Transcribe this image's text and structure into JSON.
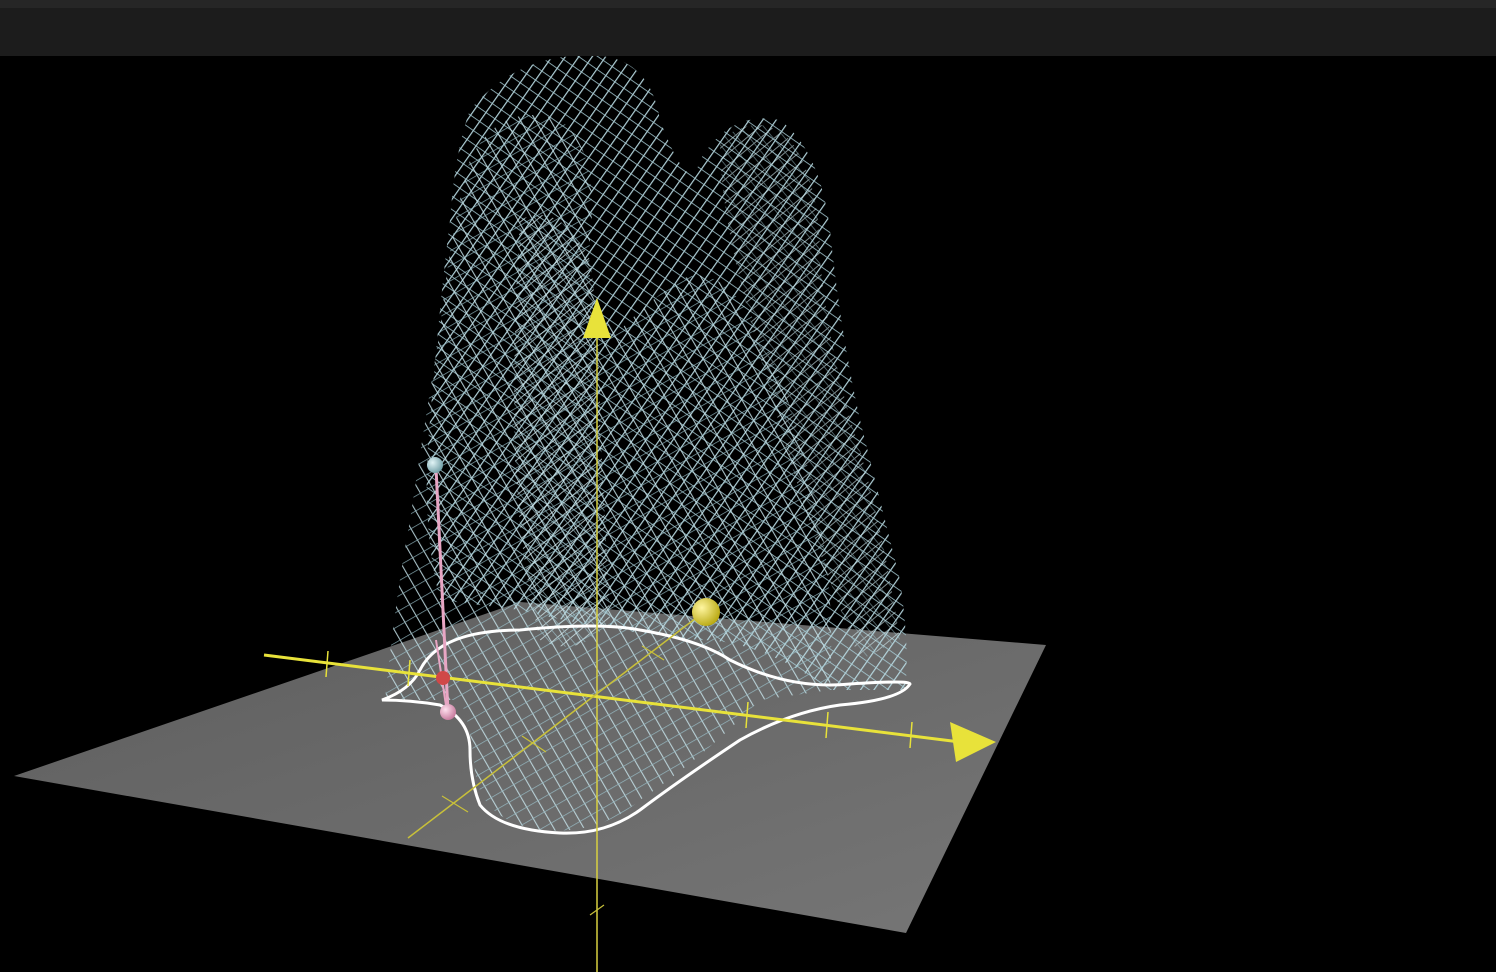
{
  "window": {
    "toolbar_bg": "#1c1c1c"
  },
  "scene": {
    "background": "#000000",
    "plane_color": "#6b6b6b",
    "surface_color": "#a9cfd8",
    "contour_color": "#ffffff",
    "axis_color": "#e8e23a",
    "probe_color": "#e8a6c4",
    "surface_label": "wireframe-surface"
  }
}
